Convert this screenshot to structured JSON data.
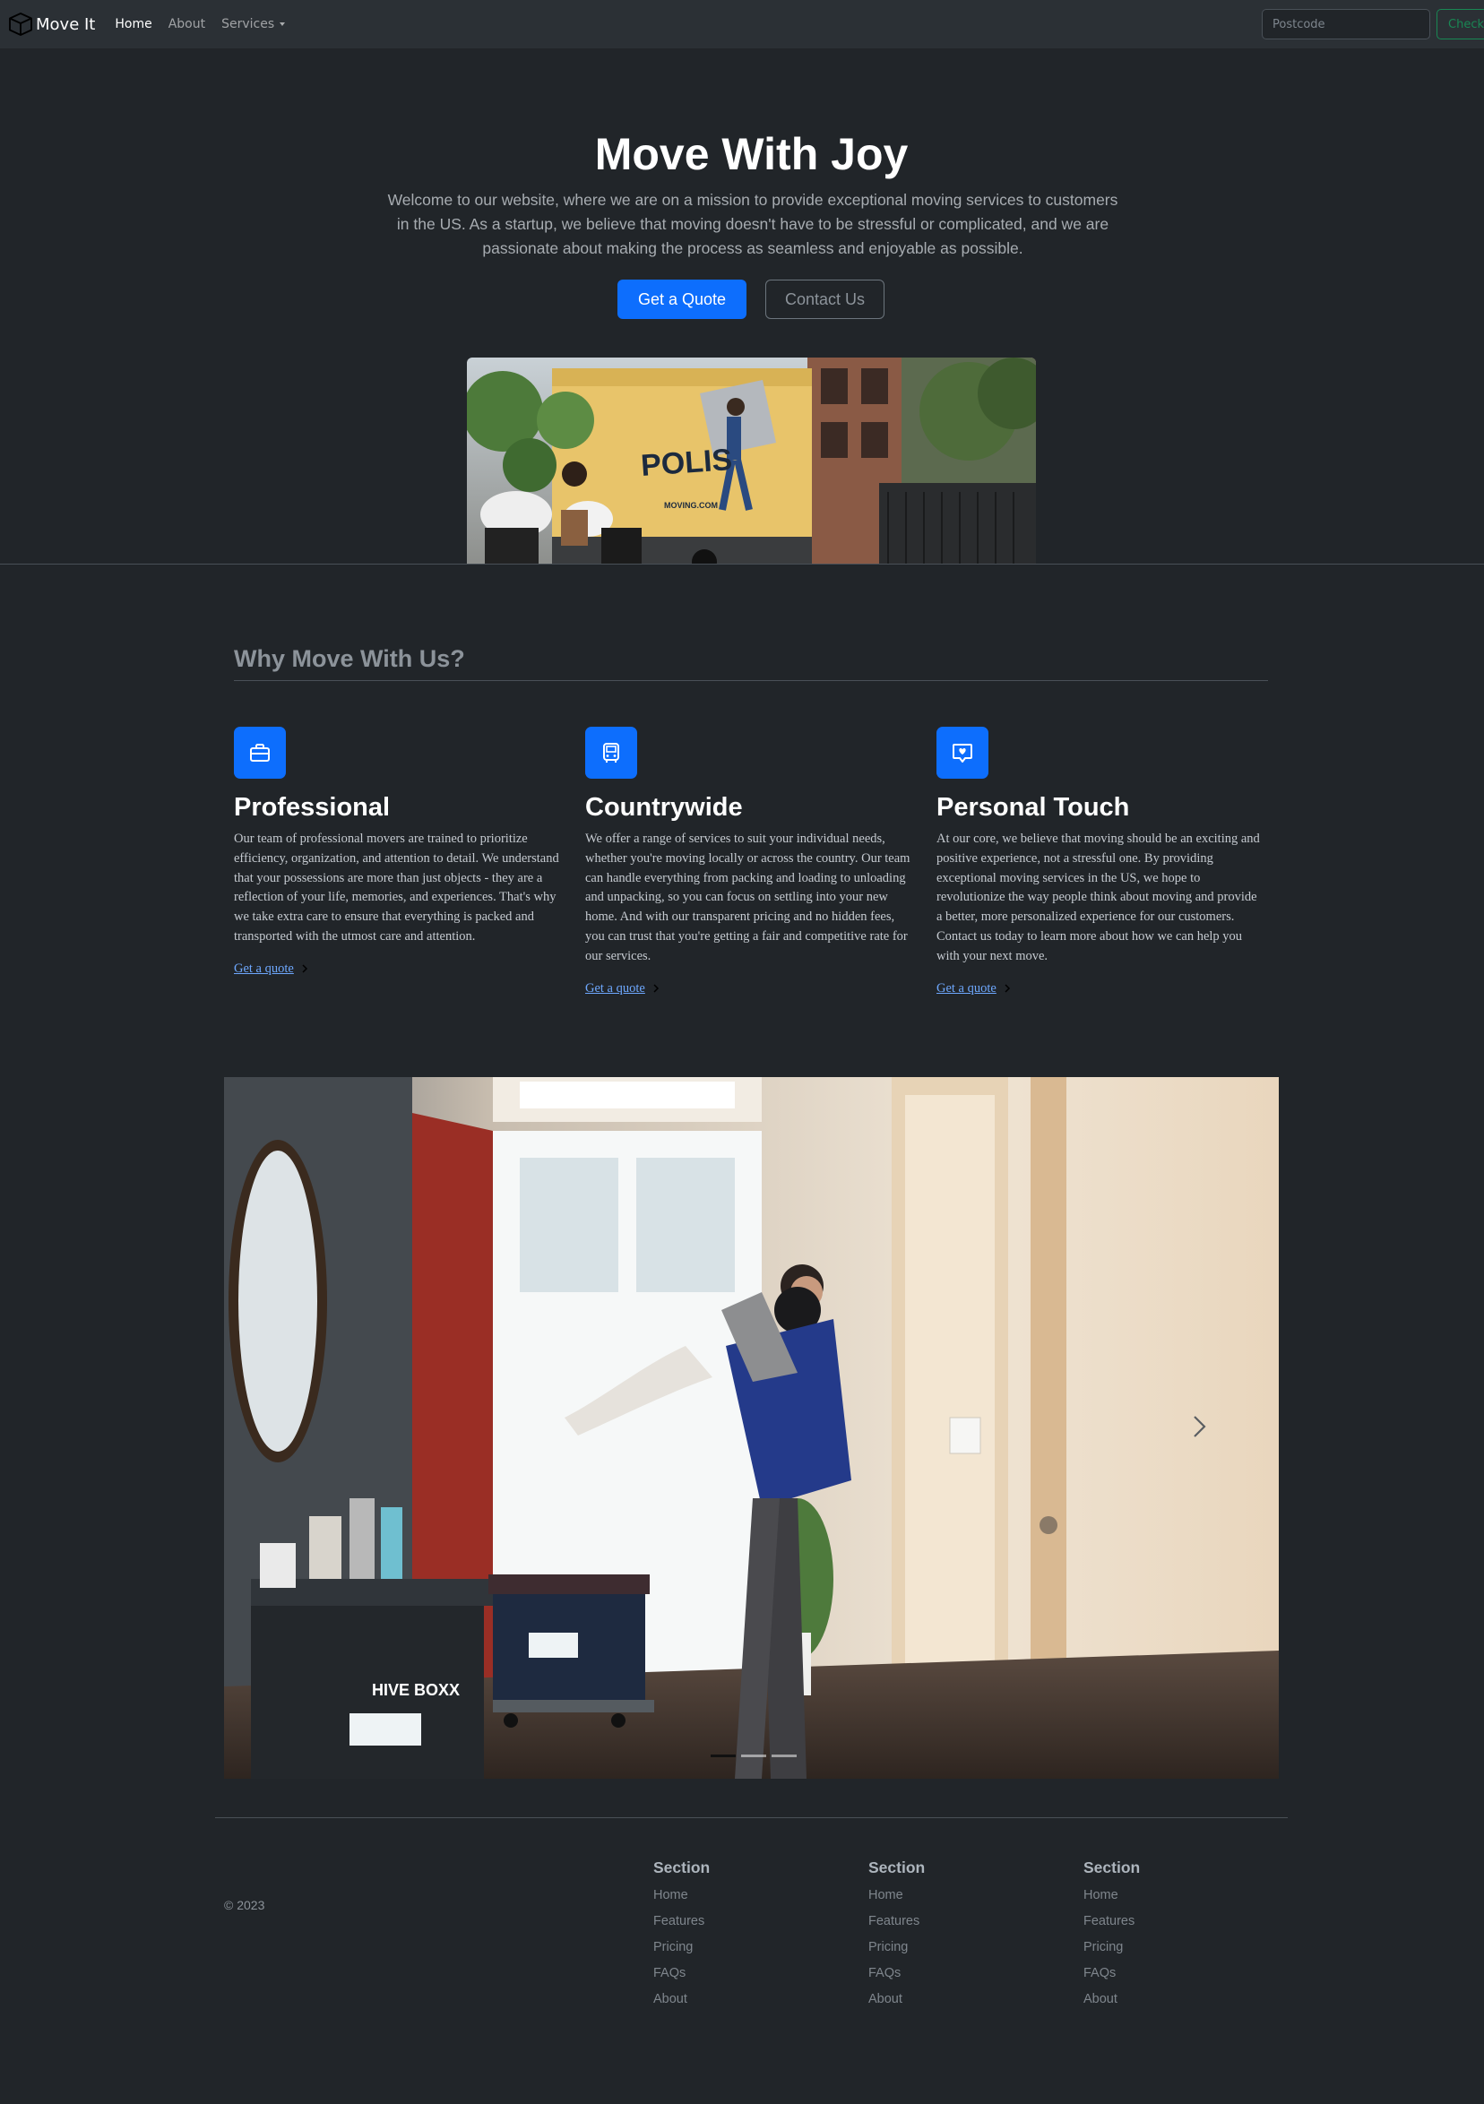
{
  "navbar": {
    "brand": "Move It",
    "brand_icon": "box-icon",
    "links": [
      {
        "label": "Home",
        "active": true
      },
      {
        "label": "About",
        "active": false
      },
      {
        "label": "Services",
        "active": false,
        "dropdown": true
      }
    ],
    "search_placeholder": "Postcode",
    "check_label": "Check"
  },
  "hero": {
    "title": "Move With Joy",
    "text": "Welcome to our website, where we are on a mission to provide exceptional moving services to customers in the US. As a startup, we believe that moving doesn't have to be stressful or complicated, and we are passionate about making the process as seamless and enjoyable as possible.",
    "primary_button": "Get a Quote",
    "secondary_button": "Contact Us",
    "truck_lettering": "POLIS",
    "truck_url": "MOVING.COM"
  },
  "features": {
    "title": "Why Move With Us?",
    "items": [
      {
        "icon": "briefcase-icon",
        "title": "Professional",
        "text": "Our team of professional movers are trained to prioritize efficiency, organization, and attention to detail. We understand that your possessions are more than just objects - they are a reflection of your life, memories, and experiences. That's why we take extra care to ensure that everything is packed and transported with the utmost care and attention.",
        "link": "Get a quote"
      },
      {
        "icon": "bus-icon",
        "title": "Countrywide",
        "text": "We offer a range of services to suit your individual needs, whether you're moving locally or across the country. Our team can handle everything from packing and loading to unloading and unpacking, so you can focus on settling into your new home. And with our transparent pricing and no hidden fees, you can trust that you're getting a fair and competitive rate for our services.",
        "link": "Get a quote"
      },
      {
        "icon": "chat-heart-icon",
        "title": "Personal Touch",
        "text": "At our core, we believe that moving should be an exciting and positive experience, not a stressful one. By providing exceptional moving services in the US, we hope to revolutionize the way people think about moving and provide a better, more personalized experience for our customers. Contact us today to learn more about how we can help you with your next move.",
        "link": "Get a quote"
      }
    ]
  },
  "carousel": {
    "box_brand": "HIVE BOXX",
    "active_index": 0,
    "slide_count": 3
  },
  "footer": {
    "copyright": "© 2023",
    "columns": [
      {
        "title": "Section",
        "links": [
          "Home",
          "Features",
          "Pricing",
          "FAQs",
          "About"
        ]
      },
      {
        "title": "Section",
        "links": [
          "Home",
          "Features",
          "Pricing",
          "FAQs",
          "About"
        ]
      },
      {
        "title": "Section",
        "links": [
          "Home",
          "Features",
          "Pricing",
          "FAQs",
          "About"
        ]
      }
    ]
  },
  "colors": {
    "background": "#212529",
    "navbar": "#2b3035",
    "primary": "#0d6efd",
    "link": "#6ea8fe",
    "success": "#198754"
  }
}
